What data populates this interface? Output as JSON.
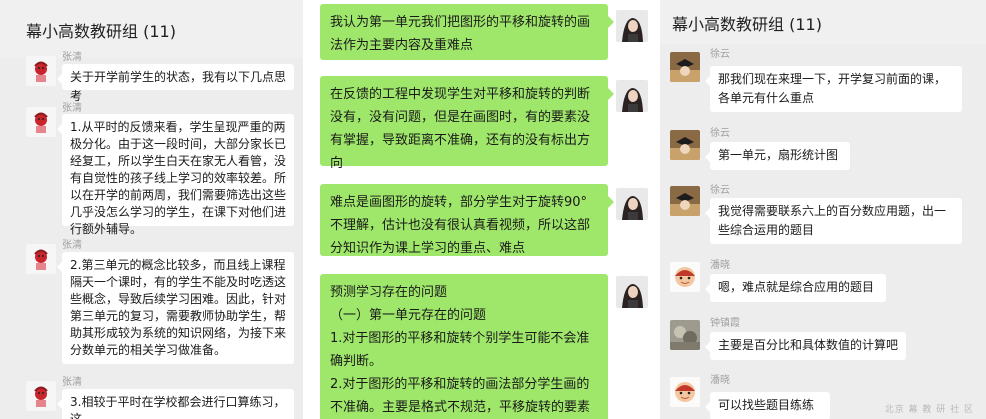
{
  "left_panel": {
    "title": "幕小高数教研组 (11)",
    "messages": [
      {
        "sender": "张清",
        "text": "关于开学前学生的状态，我有以下几点思考"
      },
      {
        "sender": "张清",
        "text": "1.从平时的反馈来看，学生呈现严重的两极分化。由于这一段时间，大部分家长已经复工，所以学生白天在家无人看管，没有自觉性的孩子线上学习的效率较差。所以在开学的前两周，我们需要筛选出这些几乎没怎么学习的学生，在课下对他们进行额外辅导。"
      },
      {
        "sender": "张清",
        "text": "2.第三单元的概念比较多，而且线上课程隔天一个课时，有的学生不能及时吃透这些概念，导致后续学习困难。因此，针对第三单元的复习，需要教师协助学生，帮助其形成较为系统的知识网络，为接下来分数单元的相关学习做准备。"
      },
      {
        "sender": "张清",
        "text": "3.相较于平时在学校都会进行口算练习，这"
      }
    ]
  },
  "middle_panel": {
    "messages": [
      {
        "text": "我认为第一单元我们把图形的平移和旋转的画法作为主要内容及重难点"
      },
      {
        "text": "在反馈的工程中发现学生对平移和旋转的判断没有，没有问题，但是在画图时，有的要素没有掌握，导致距离不准确，还有的没有标出方向"
      },
      {
        "text": "难点是画图形的旋转，部分学生对于旋转90°不理解，估计也没有很认真看视频，所以这部分知识作为课上学习的重点、难点"
      },
      {
        "text": "预测学习存在的问题\n（一）第一单元存在的问题\n1.对于图形的平移和旋转个别学生可能不会准确判断。\n2.对于图形的平移和旋转的画法部分学生画的不准确。主要是格式不规范，平移旋转的要素没有准确掌握"
      }
    ]
  },
  "right_panel": {
    "title": "幕小高数教研组 (11)",
    "messages": [
      {
        "sender": "徐云",
        "text": "那我们现在来理一下，开学复习前面的课，各单元有什么重点"
      },
      {
        "sender": "徐云",
        "text": "第一单元，扇形统计图"
      },
      {
        "sender": "徐云",
        "text": "我觉得需要联系六上的百分数应用题，出一些综合运用的题目"
      },
      {
        "sender": "潘晓",
        "text": "嗯，难点就是综合应用的题目"
      },
      {
        "sender": "钟镇霞",
        "text": "主要是百分比和具体数值的计算吧"
      },
      {
        "sender": "潘晓",
        "text": "可以找些题目练练"
      }
    ],
    "watermark": "北京 幕 教 研 社 区"
  },
  "colors": {
    "chat_bg": "#ededed",
    "self_bubble": "#9fe76a",
    "other_bubble": "#ffffff"
  },
  "icons": [
    "avatar-girl-icon",
    "avatar-woman-icon",
    "avatar-graduate-icon",
    "avatar-child-icon",
    "avatar-photo-icon"
  ]
}
